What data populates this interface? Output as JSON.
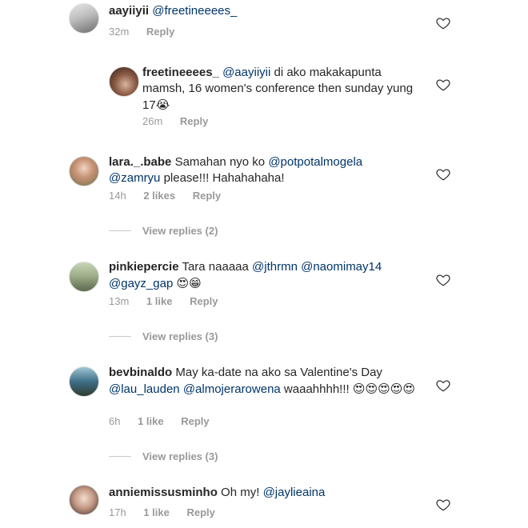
{
  "comments": [
    {
      "username": "aayiiyii",
      "body": [
        {
          "t": "m",
          "v": "@freetineeees_"
        }
      ],
      "time": "32m",
      "likes": "",
      "reply": "Reply"
    },
    {
      "username": "freetineeees_",
      "body": [
        {
          "t": "m",
          "v": "@aayiiyii"
        },
        {
          "t": "t",
          "v": " di ako makakapunta mamsh, 16 women's conference then sunday yung 17"
        },
        {
          "t": "e",
          "v": "😭"
        }
      ],
      "time": "26m",
      "likes": "",
      "reply": "Reply"
    },
    {
      "username": "lara._.babe",
      "body": [
        {
          "t": "t",
          "v": "Samahan nyo ko "
        },
        {
          "t": "m",
          "v": "@potpotalmogela"
        },
        {
          "t": "t",
          "v": " "
        },
        {
          "t": "m",
          "v": "@zamryu"
        },
        {
          "t": "t",
          "v": "  please!!! Hahahahaha!"
        }
      ],
      "time": "14h",
      "likes": "2 likes",
      "reply": "Reply",
      "view_replies": "View replies (2)"
    },
    {
      "username": "pinkiepercie",
      "body": [
        {
          "t": "t",
          "v": "Tara naaaaa "
        },
        {
          "t": "m",
          "v": "@jthrmn"
        },
        {
          "t": "t",
          "v": " "
        },
        {
          "t": "m",
          "v": "@naomimay14"
        },
        {
          "t": "t",
          "v": " "
        },
        {
          "t": "m",
          "v": "@gayz_gap"
        },
        {
          "t": "t",
          "v": " "
        },
        {
          "t": "e",
          "v": "😍"
        },
        {
          "t": "e",
          "v": "😁"
        }
      ],
      "time": "13m",
      "likes": "1 like",
      "reply": "Reply",
      "view_replies": "View replies (3)"
    },
    {
      "username": "bevbinaldo",
      "body": [
        {
          "t": "t",
          "v": "May ka-date na ako sa Valentine's Day "
        },
        {
          "t": "m",
          "v": "@lau_lauden"
        },
        {
          "t": "t",
          "v": " "
        },
        {
          "t": "m",
          "v": "@almojerarowena"
        },
        {
          "t": "t",
          "v": " waaahhhh!!! "
        },
        {
          "t": "e",
          "v": "😍😍😍😍😍"
        }
      ],
      "time": "6h",
      "likes": "1 like",
      "reply": "Reply",
      "view_replies": "View replies (3)"
    },
    {
      "username": "anniemissusminho",
      "body": [
        {
          "t": "t",
          "v": "Oh my! "
        },
        {
          "t": "m",
          "v": "@jaylieaina"
        }
      ],
      "time": "17h",
      "likes": "1 like",
      "reply": "Reply"
    }
  ],
  "colors": {
    "mention": "#003569",
    "meta": "#999999",
    "text": "#262626"
  },
  "icons": {
    "like": "heart-outline-icon"
  }
}
